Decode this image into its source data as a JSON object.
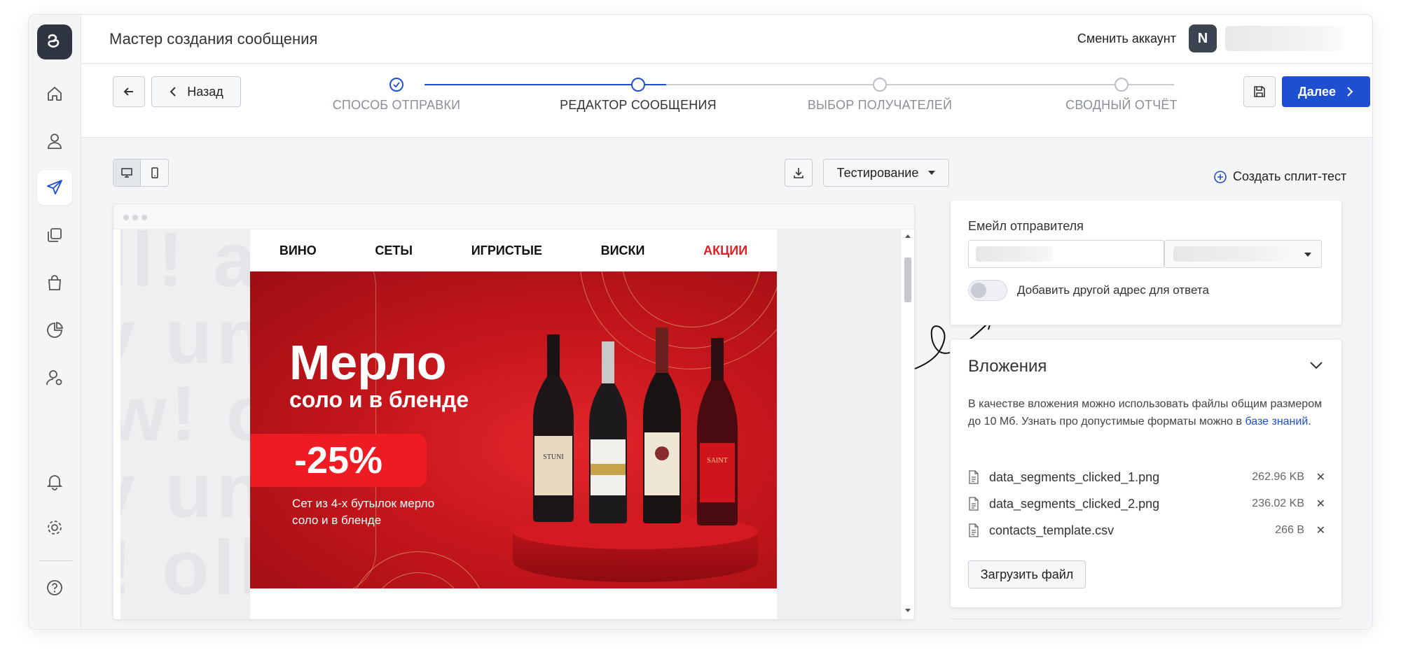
{
  "header": {
    "title": "Мастер создания сообщения",
    "switch_account": "Сменить аккаунт",
    "avatar_initial": "N"
  },
  "nav": {
    "back_label": "Назад",
    "next_label": "Далее",
    "steps": [
      {
        "label": "СПОСОБ ОТПРАВКИ",
        "state": "done"
      },
      {
        "label": "РЕДАКТОР СООБЩЕНИЯ",
        "state": "current"
      },
      {
        "label": "ВЫБОР ПОЛУЧАТЕЛЕЙ",
        "state": "pending"
      },
      {
        "label": "СВОДНЫЙ ОТЧЁТ",
        "state": "pending"
      }
    ]
  },
  "toolbar": {
    "testing_label": "Тестирование",
    "split_test_label": "Создать сплит-тест"
  },
  "email": {
    "menu": [
      "ВИНО",
      "СЕТЫ",
      "ИГРИСТЫЕ",
      "ВИСКИ",
      "АКЦИИ"
    ],
    "banner_title": "Мерло",
    "banner_subtitle": "соло и в бленде",
    "discount": "-25%",
    "note": "Сет из 4-х бутылок мерло соло и в бленде",
    "bottle_labels": [
      "STUNI",
      "",
      "",
      "SAINT"
    ]
  },
  "sender": {
    "label": "Емейл отправителя",
    "reply_toggle_label": "Добавить другой адрес для ответа",
    "reply_toggle_on": false
  },
  "attachments": {
    "title": "Вложения",
    "desc_prefix": "В качестве вложения можно использовать файлы общим размером до 10 Мб. Узнать про допустимые форматы можно в ",
    "desc_link": "базе знаний",
    "desc_suffix": ".",
    "files": [
      {
        "name": "data_segments_clicked_1.png",
        "size": "262.96 KB"
      },
      {
        "name": "data_segments_clicked_2.png",
        "size": "236.02 KB"
      },
      {
        "name": "contacts_template.csv",
        "size": "266 B"
      }
    ],
    "upload_label": "Загрузить файл"
  },
  "colors": {
    "primary": "#1f4fd1",
    "sidebar_logo": "#2f3540",
    "sale": "#e31e24",
    "banner": "#c5161c"
  }
}
